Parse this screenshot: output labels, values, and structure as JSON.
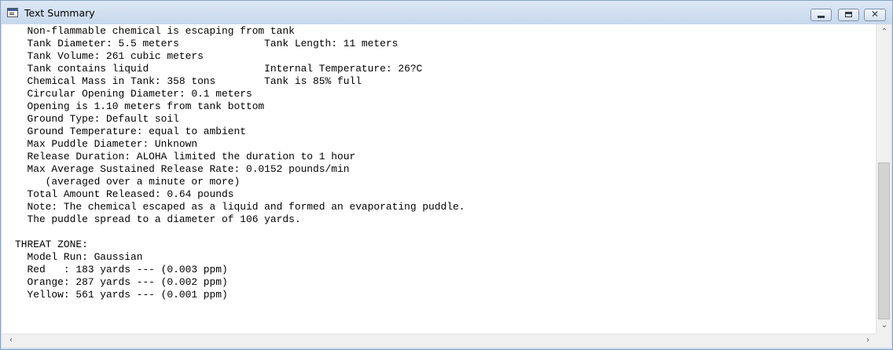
{
  "window": {
    "title": "Text Summary"
  },
  "controls": {
    "minimize": "–",
    "maximize": "□",
    "close": "✕"
  },
  "icons": {
    "app": "text-document-icon",
    "up": "scroll-up-arrow-icon",
    "down": "scroll-down-arrow-icon",
    "left": "scroll-left-arrow-icon",
    "right": "scroll-right-arrow-icon"
  },
  "scrollbar": {
    "arrow_up": "⌃",
    "arrow_down": "⌄",
    "arrow_left": "‹",
    "arrow_right": "›"
  },
  "lines": [
    "  Non-flammable chemical is escaping from tank",
    "  Tank Diameter: 5.5 meters              Tank Length: 11 meters",
    "  Tank Volume: 261 cubic meters",
    "  Tank contains liquid                   Internal Temperature: 26?C",
    "  Chemical Mass in Tank: 358 tons        Tank is 85% full",
    "  Circular Opening Diameter: 0.1 meters",
    "  Opening is 1.10 meters from tank bottom",
    "  Ground Type: Default soil",
    "  Ground Temperature: equal to ambient",
    "  Max Puddle Diameter: Unknown",
    "  Release Duration: ALOHA limited the duration to 1 hour",
    "  Max Average Sustained Release Rate: 0.0152 pounds/min",
    "     (averaged over a minute or more)",
    "  Total Amount Released: 0.64 pounds",
    "  Note: The chemical escaped as a liquid and formed an evaporating puddle.",
    "  The puddle spread to a diameter of 106 yards.",
    "",
    "THREAT ZONE:",
    "  Model Run: Gaussian",
    "  Red   : 183 yards --- (0.003 ppm)",
    "  Orange: 287 yards --- (0.002 ppm)",
    "  Yellow: 561 yards --- (0.001 ppm)"
  ]
}
